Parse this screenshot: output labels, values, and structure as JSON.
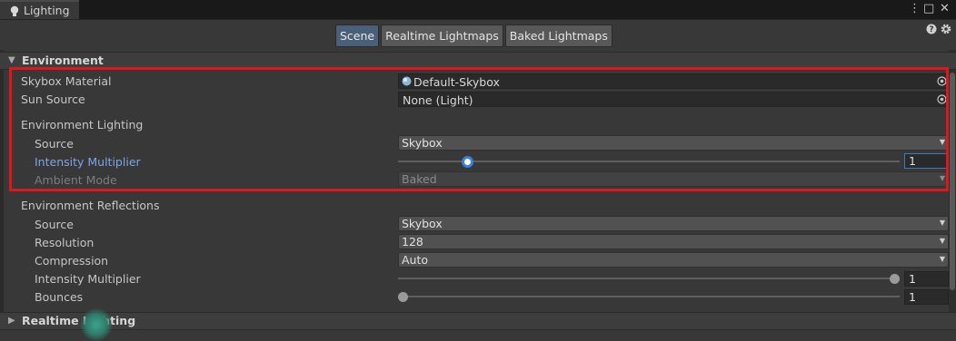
{
  "window": {
    "tab_title": "Lighting",
    "menu_glyph": "⋮",
    "maximize_glyph": "□",
    "close_glyph": "✕"
  },
  "mode_tabs": [
    {
      "label": "Scene",
      "active": true
    },
    {
      "label": "Realtime Lightmaps",
      "active": false
    },
    {
      "label": "Baked Lightmaps",
      "active": false
    }
  ],
  "sections": {
    "environment": {
      "title": "Environment",
      "expanded": true
    },
    "realtime_lighting": {
      "title": "Realtime Lighting",
      "expanded": false
    }
  },
  "environment": {
    "skybox_material": {
      "label": "Skybox Material",
      "value": "Default-Skybox"
    },
    "sun_source": {
      "label": "Sun Source",
      "value": "None (Light)"
    },
    "environment_lighting": {
      "title": "Environment Lighting",
      "source": {
        "label": "Source",
        "value": "Skybox"
      },
      "intensity_multiplier": {
        "label": "Intensity Multiplier",
        "value": "1",
        "slider_fraction": 0.13
      },
      "ambient_mode": {
        "label": "Ambient Mode",
        "value": "Baked",
        "disabled": true
      }
    },
    "environment_reflections": {
      "title": "Environment Reflections",
      "source": {
        "label": "Source",
        "value": "Skybox"
      },
      "resolution": {
        "label": "Resolution",
        "value": "128"
      },
      "compression": {
        "label": "Compression",
        "value": "Auto"
      },
      "intensity_multiplier": {
        "label": "Intensity Multiplier",
        "value": "1",
        "slider_fraction": 1.0
      },
      "bounces": {
        "label": "Bounces",
        "value": "1",
        "slider_fraction": 0.0
      }
    }
  },
  "colors": {
    "highlight_box": "#e0161f",
    "active_label": "#7ba5e8",
    "active_tab": "#4a5f78"
  },
  "icons": {
    "window": "lightbulb-icon",
    "help": "help-icon",
    "settings": "gear-icon",
    "object_picker": "object-picker-icon"
  }
}
